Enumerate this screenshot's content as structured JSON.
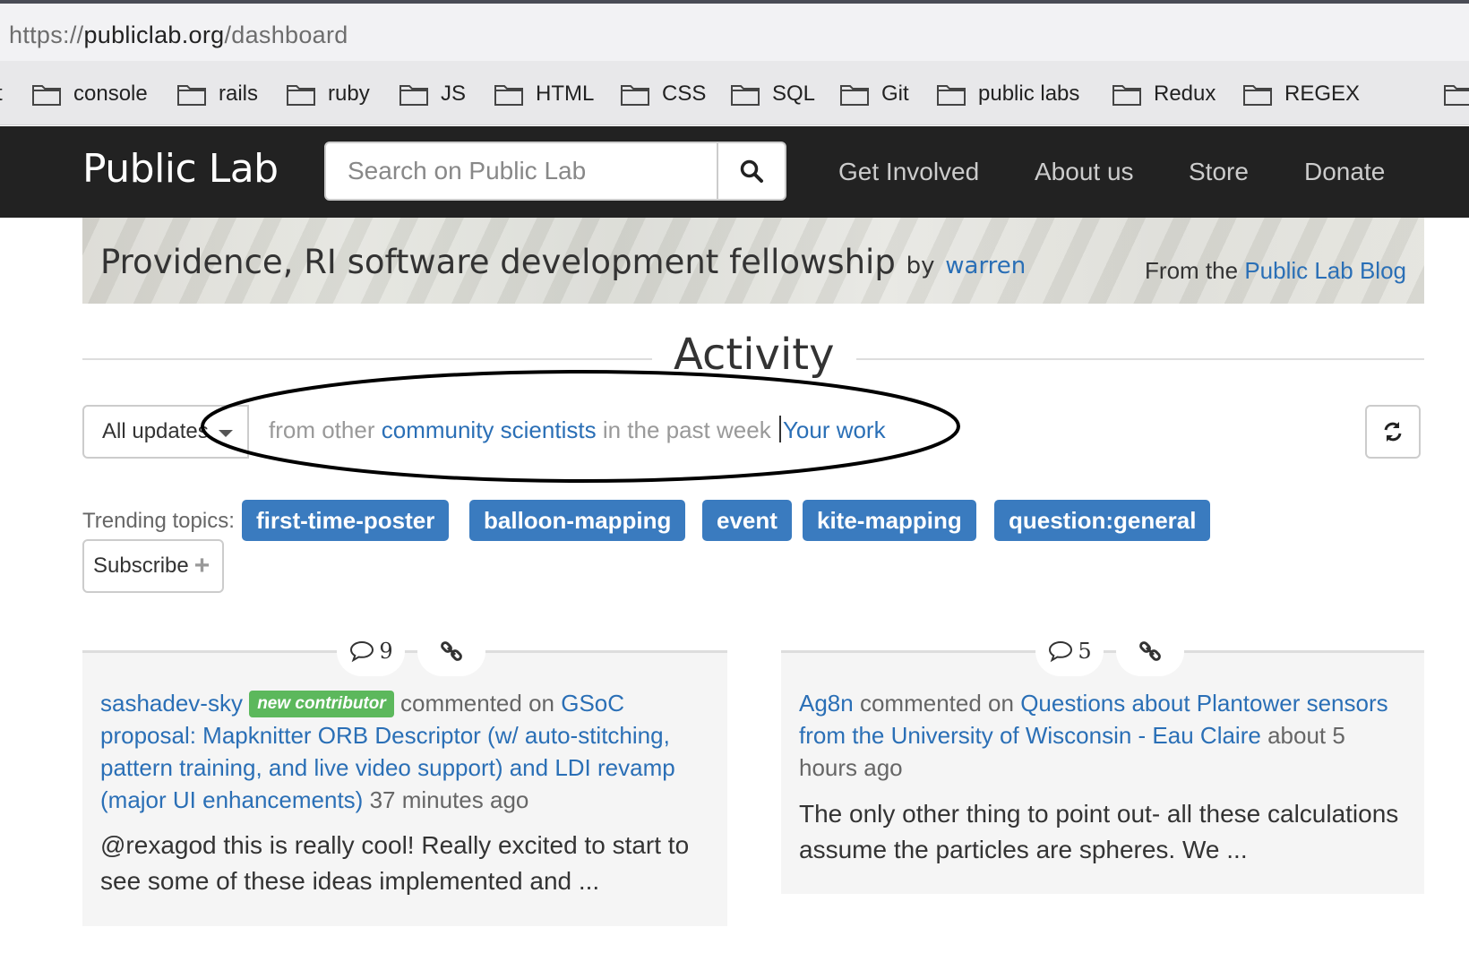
{
  "browser": {
    "url_protocol": "https://",
    "url_host": "publiclab.org",
    "url_path": "/dashboard",
    "bookmark_partial": "t",
    "bookmarks": [
      "console",
      "rails",
      "ruby",
      "JS",
      "HTML",
      "CSS",
      "SQL",
      "Git",
      "public labs",
      "Redux",
      "REGEX"
    ]
  },
  "navbar": {
    "brand": "Public Lab",
    "search_placeholder": "Search on Public Lab",
    "links": [
      "Get Involved",
      "About us",
      "Store",
      "Donate"
    ]
  },
  "banner": {
    "title": "Providence, RI software development fellowship",
    "by": "by",
    "author": "warren",
    "from_prefix": "From the",
    "from_link": "Public Lab Blog"
  },
  "activity": {
    "heading": "Activity",
    "dropdown_value": "All updates",
    "filter_prefix": "from other",
    "filter_link": "community scientists",
    "filter_suffix": "in the past week",
    "your_work": "Your work"
  },
  "trending": {
    "label": "Trending topics:",
    "tags": [
      "first-time-poster",
      "balloon-mapping",
      "event",
      "kite-mapping",
      "question:general"
    ],
    "subscribe_label": "Subscribe"
  },
  "cards": [
    {
      "comments": "9",
      "user": "sashadev-sky",
      "badge": "new contributor",
      "action": "commented on",
      "link": "GSoC proposal: Mapknitter ORB Descriptor (w/ auto-stitching, pattern training, and live video support) and LDI revamp (major UI enhancements)",
      "time": "37 minutes ago",
      "excerpt": "@rexagod this is really cool! Really excited to start to see some of these ideas implemented and ..."
    },
    {
      "comments": "5",
      "user": "Ag8n",
      "action": "commented on",
      "link": "Questions about Plantower sensors from the University of Wisconsin - Eau Claire",
      "time": "about 5 hours ago",
      "excerpt": "The only other thing to point out- all these calculations assume the particles are spheres. We ..."
    }
  ],
  "colors": {
    "navbar": "#222222",
    "link": "#2a6fb6",
    "tag": "#3a7bbf",
    "badge": "#5cb85c"
  }
}
